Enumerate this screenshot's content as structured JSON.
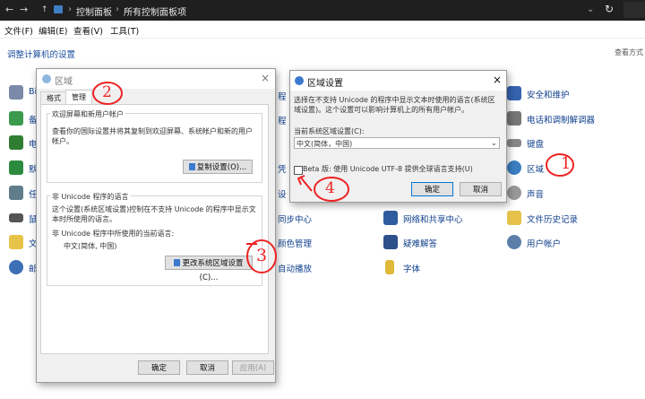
{
  "window": {
    "nav": {
      "back": "←",
      "forward": "→",
      "up": "↑"
    },
    "breadcrumb": [
      "控制面板",
      "所有控制面板项"
    ],
    "breadcrumb_sep": "›",
    "menu": [
      "文件(F)",
      "编辑(E)",
      "查看(V)",
      "工具(T)"
    ],
    "heading": "调整计算机的设置",
    "view_by": "查看方式"
  },
  "control_panel": {
    "left_items": [
      "Bi",
      "备",
      "电",
      "默",
      "任",
      "鼠",
      "文",
      "邮"
    ],
    "mid_items": [
      "程",
      "程",
      "设",
      "设",
      "同步中心",
      "颜色管理",
      "自动播放",
      "凭"
    ],
    "mid2_items": [
      "网络和共享中心",
      "疑难解答",
      "字体"
    ],
    "right_items": [
      "安全和维护",
      "电话和调制解调器",
      "键盘",
      "区域",
      "声音",
      "文件历史记录",
      "用户帐户"
    ]
  },
  "region_dialog": {
    "title": "区域",
    "close": "×",
    "tabs": [
      "格式",
      "管理"
    ],
    "welcome": {
      "title": "欢迎屏幕和新用户帐户",
      "desc": "查看你的国际设置并将其复制到欢迎屏幕、系统帐户和新的用户帐户。",
      "copy_button": "复制设置(O)..."
    },
    "unicode": {
      "title": "非 Unicode 程序的语言",
      "desc": "这个设置(系统区域设置)控制在不支持 Unicode 的程序中显示文本时所使用的语言。",
      "current_label": "非 Unicode 程序中所使用的当前语言:",
      "current_value": "中文(简体, 中国)",
      "change_button": "更改系统区域设置(C)..."
    },
    "ok": "确定",
    "cancel": "取消",
    "apply": "应用(A)"
  },
  "locale_dialog": {
    "title": "区域设置",
    "close": "×",
    "desc": "选择在不支持 Unicode 的程序中显示文本时使用的语言(系统区域设置)。这个设置可以影响计算机上的所有用户帐户。",
    "current_label": "当前系统区域设置(C):",
    "current_value": "中文(简体，中国)",
    "beta_label": "Beta 版: 使用 Unicode UTF-8 提供全球语言支持(U)",
    "ok": "确定",
    "cancel": "取消"
  },
  "annotations": [
    "1",
    "2",
    "3",
    "4"
  ],
  "colors": {
    "annotation": "#e22222",
    "link": "#1a4f9c",
    "accent": "#0078d7"
  }
}
